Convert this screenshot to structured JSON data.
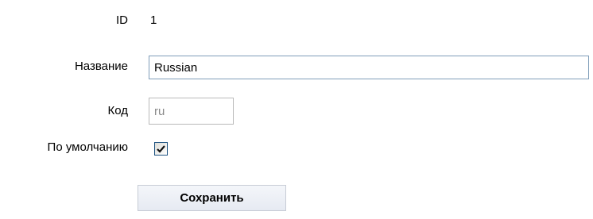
{
  "form": {
    "id_label": "ID",
    "id_value": "1",
    "name_label": "Название",
    "name_value": "Russian",
    "code_label": "Код",
    "code_value": "ru",
    "default_label": "По умолчанию",
    "default_checked": true,
    "save_label": "Сохранить"
  },
  "colors": {
    "input_border": "#7f9db9",
    "disabled_border": "#b9b9b9",
    "disabled_text": "#8a8a8a",
    "checkbox_border": "#1c5180",
    "button_border": "#c7ccd6",
    "button_bg": "#eef1f6"
  },
  "icons": {
    "checkbox_mark": "check-mark-icon"
  }
}
